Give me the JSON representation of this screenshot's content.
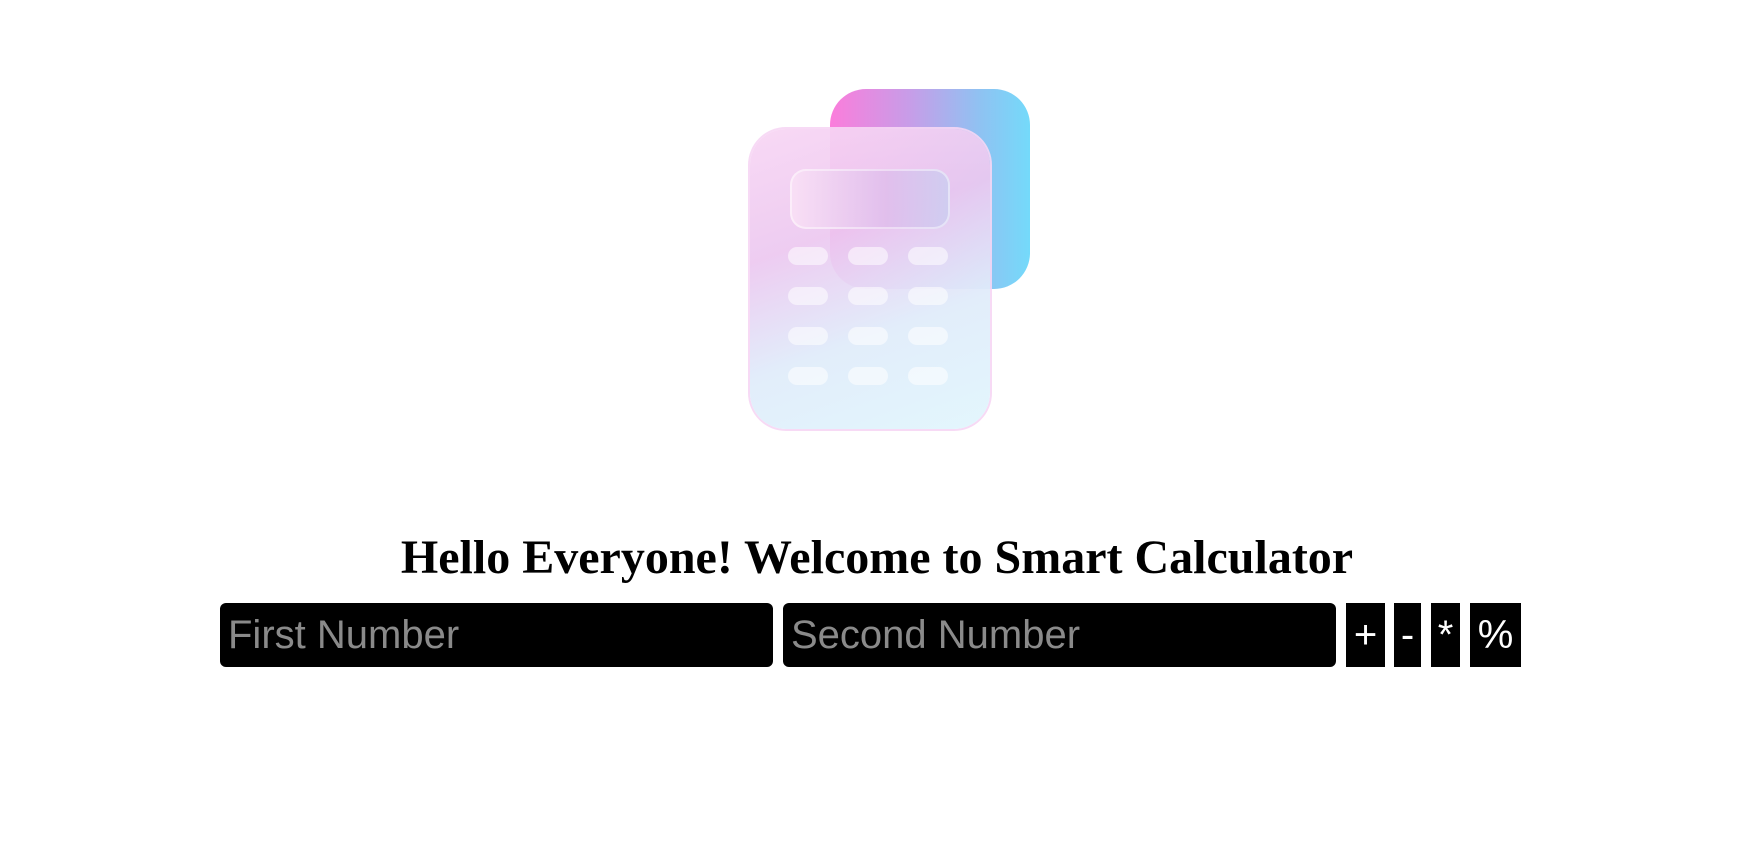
{
  "heading": "Hello Everyone! Welcome to Smart Calculator",
  "inputs": {
    "first": {
      "placeholder": "First Number",
      "value": ""
    },
    "second": {
      "placeholder": "Second Number",
      "value": ""
    }
  },
  "operations": {
    "add": "+",
    "subtract": "-",
    "multiply": "*",
    "modulo": "%"
  },
  "logo": {
    "icon": "calculator-icon",
    "colors": {
      "back_gradient": [
        "#fb7ddb",
        "#c79de8",
        "#8fc2f2",
        "#74dafa"
      ],
      "front_tint": "#f6d6f4"
    }
  },
  "colors": {
    "background": "#ffffff",
    "control_background": "#000000",
    "control_text": "#ffffff",
    "placeholder_text": "#8a8a8a"
  }
}
